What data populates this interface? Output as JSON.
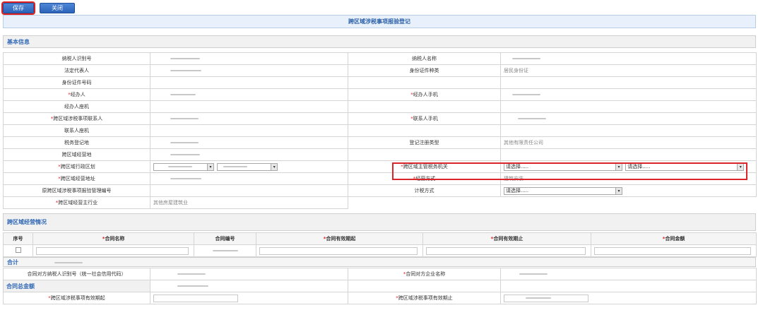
{
  "toolbar": {
    "save_label": "保存",
    "close_label": "关闭"
  },
  "page_title": "跨区域涉税事项报验登记",
  "sections": {
    "basic": "基本信息",
    "business": "跨区域经营情况",
    "total": "合计",
    "contract_total": "合同总金额"
  },
  "basic": {
    "taxpayer_id": "纳税人识别号",
    "taxpayer_name": "纳税人名称",
    "legal_rep": "法定代表人",
    "id_type": "身份证件种类",
    "id_type_value": "居民身份证",
    "id_number": "身份证件号码",
    "handler": "经办人",
    "handler_mobile": "经办人手机",
    "handler_phone": "经办人座机",
    "contact": "跨区域涉税事项联系人",
    "contact_mobile": "联系人手机",
    "contact_phone": "联系人座机",
    "tax_reg_place": "税务登记地",
    "reg_type": "登记注册类型",
    "reg_type_value": "其他有限责任公司",
    "biz_place": "跨区域经营地",
    "admin_region": "跨区域行政区划",
    "tax_authority": "跨区域主管税务机关",
    "tax_authority_sel1": "请选择.....",
    "tax_authority_sel2": "请选择.....",
    "biz_address": "跨区域经营地址",
    "biz_method": "经营方式",
    "biz_method_value": "建筑安装",
    "orig_mgmt_no": "原跨区域涉税事项报验管理编号",
    "tax_method": "计税方式",
    "tax_method_value": "请选择.....",
    "main_industry": "跨区域经营主行业",
    "main_industry_value": "其他房屋建筑业"
  },
  "contract_table": {
    "headers": [
      "序号",
      "合同名称",
      "合同编号",
      "合同有效期起",
      "合同有效期止",
      "合同金额"
    ]
  },
  "counterparty": {
    "taxpayer_id": "合同对方纳税人识别号（统一社会信用代码）",
    "company_name": "合同对方企业名称"
  },
  "validity": {
    "start": "跨区域涉税事项有效期起",
    "end": "跨区域涉税事项有效期止"
  },
  "colors": {
    "accent": "#2a63b8",
    "required": "#e02020",
    "highlight": "#d8262a"
  }
}
